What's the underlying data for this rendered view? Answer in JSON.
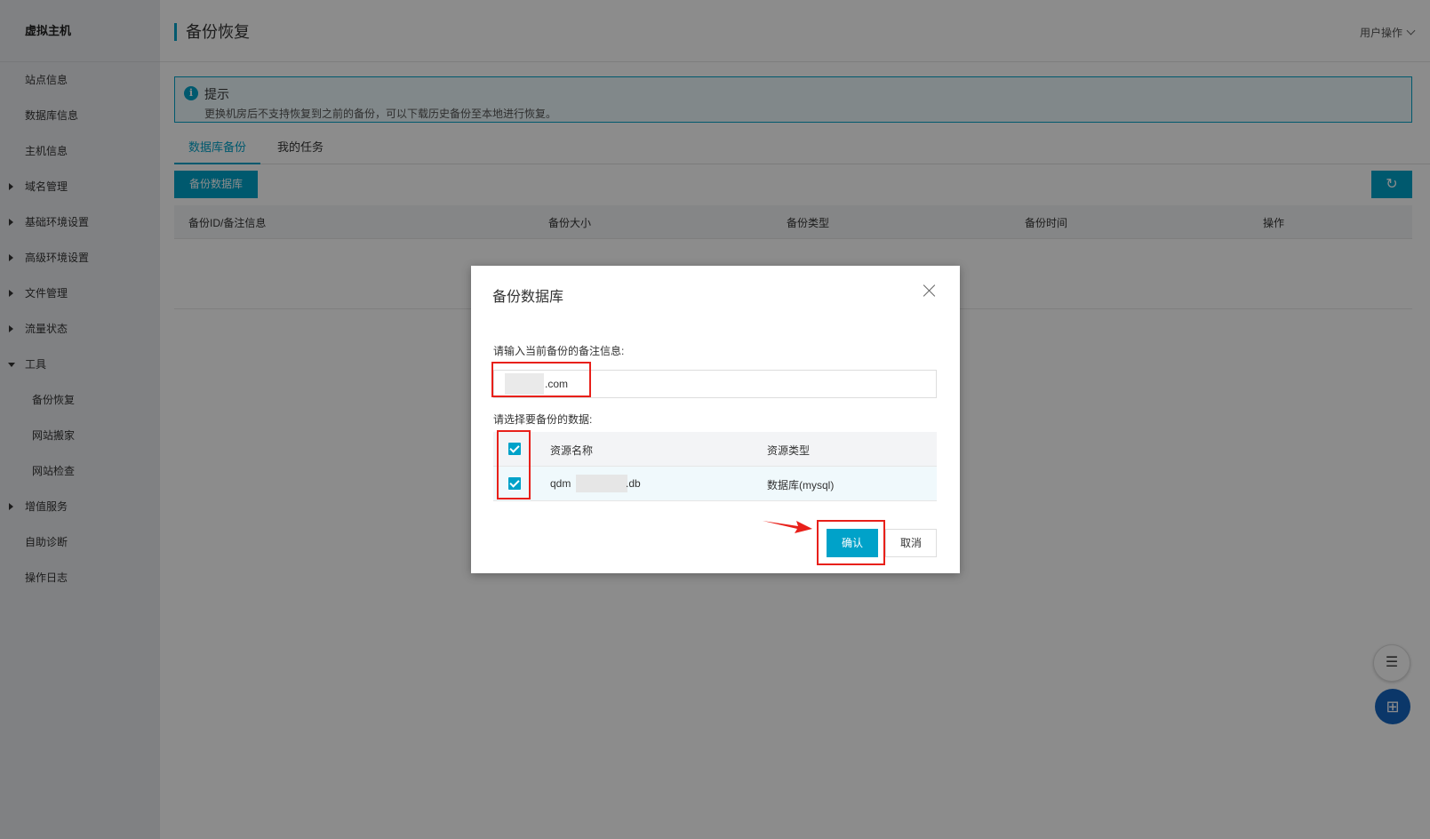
{
  "sidebar": {
    "brand": "虚拟主机",
    "items": [
      {
        "label": "站点信息"
      },
      {
        "label": "数据库信息"
      },
      {
        "label": "主机信息"
      },
      {
        "label": "域名管理"
      },
      {
        "label": "基础环境设置"
      },
      {
        "label": "高级环境设置"
      },
      {
        "label": "文件管理"
      },
      {
        "label": "流量状态"
      },
      {
        "label": "工具"
      },
      {
        "label": "备份恢复"
      },
      {
        "label": "网站搬家"
      },
      {
        "label": "网站检查"
      },
      {
        "label": "增值服务"
      },
      {
        "label": "自助诊断"
      },
      {
        "label": "操作日志"
      }
    ]
  },
  "header": {
    "title": "备份恢复",
    "user_menu": "用户操作"
  },
  "tip": {
    "title": "提示",
    "text": "更换机房后不支持恢复到之前的备份，可以下载历史备份至本地进行恢复。"
  },
  "tabs": [
    {
      "label": "数据库备份"
    },
    {
      "label": "我的任务"
    }
  ],
  "toolbar": {
    "backup_button": "备份数据库",
    "refresh_icon": "refresh-icon"
  },
  "table": {
    "columns": [
      "备份ID/备注信息",
      "备份大小",
      "备份类型",
      "备份时间",
      "操作"
    ]
  },
  "modal": {
    "title": "备份数据库",
    "note_label": "请输入当前备份的备注信息:",
    "note_value": ".com",
    "data_label": "请选择要备份的数据:",
    "resource_columns": [
      "资源名称",
      "资源类型"
    ],
    "resources": [
      {
        "name_prefix": "qdm",
        "name_suffix": ".db",
        "type": "数据库(mysql)",
        "checked": true
      }
    ],
    "confirm": "确认",
    "cancel": "取消"
  },
  "colors": {
    "accent": "#00a2c9",
    "annotation": "#e8201a",
    "float_button": "#1565c0"
  }
}
